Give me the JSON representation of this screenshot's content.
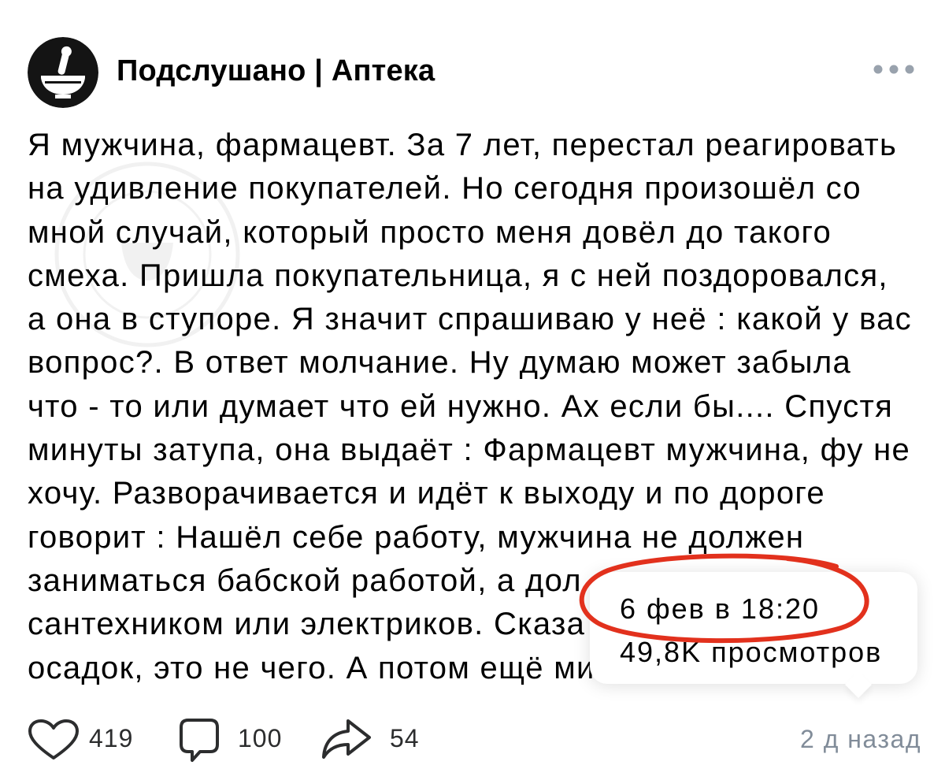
{
  "post": {
    "author_name": "Подслушано | Аптека",
    "avatar_icon": "pharmacy-mortar-pestle-avatar",
    "more_icon": "more-horizontal-icon",
    "text_lines": [
      "Я мужчина, фармацевт. За 7 лет, перестал реагировать",
      "на удивление покупателей. Но сегодня произошёл со",
      "мной случай, который просто меня довёл до такого",
      "смеха. Пришла покупательница, я с ней поздоровался,",
      "а она в ступоре. Я значит спрашиваю у неё : какой у вас",
      "вопрос?. В ответ молчание. Ну думаю может забыла",
      "что - то или думает что ей нужно. Ах если бы.... Спустя",
      "минуты затупа, она выдаёт : Фармацевт мужчина, фу не",
      "хочу. Разворачивается и идёт к выходу и по дороге",
      "говорит : Нашёл себе работу, мужчина не должен",
      "заниматься бабской работой, а дол",
      "сантехником или электриков. Сказа",
      "осадок, это не чего. А потом ещё ми"
    ],
    "time_ago": "2 д назад"
  },
  "actions": {
    "like": {
      "icon": "heart-icon",
      "count": "419"
    },
    "comment": {
      "icon": "comment-icon",
      "count": "100"
    },
    "share": {
      "icon": "share-icon",
      "count": "54"
    }
  },
  "tooltip": {
    "date": "6 фев в 18:20",
    "views": "49,8K просмотров"
  },
  "colors": {
    "text": "#000000",
    "secondary": "#818c99",
    "icon": "#2c2d2e",
    "more": "#99a2ad",
    "annotation": "#e2311d",
    "tooltip_bg": "#ffffff"
  }
}
